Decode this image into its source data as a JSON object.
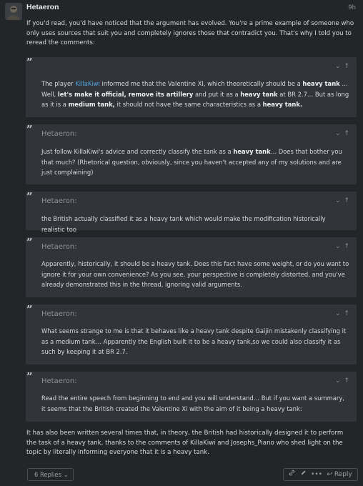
{
  "post": {
    "username": "Hetaeron",
    "time": "9h",
    "intro": "If you'd read, you'd have noticed that the argument has evolved. You're a prime example of someone who only uses sources that suit you and completely ignores those that contradict you. That's why I told you to reread the comments:",
    "closing": "It has also been written several times that, in theory, the British had historically designed it to perform the task of a heavy tank, thanks to the comments of KillaKiwi and Josephs_Piano who shed light on the topic by literally informing everyone that it is a heavy tank."
  },
  "quotes": [
    {
      "author": "Hetaeron:",
      "body_parts": {
        "a": "The player ",
        "link": "KillaKiwi",
        "b": " informed me that the Valentine XI, which theoretically should be a ",
        "c": "heavy tank",
        "d": " … Well, ",
        "e": "let's make it official, remove its artillery",
        "f": " and put it as a ",
        "g": "heavy tank",
        "h": " at BR 2.7… But as long as it is a ",
        "i": "medium tank,",
        "j": " it should not have the same characteristics as a ",
        "k": "heavy tank."
      }
    },
    {
      "author": "Hetaeron:",
      "body_parts": {
        "a": "Just follow KillaKiwi's advice and correctly classify the tank as a ",
        "b": "heavy tank",
        "c": "… Does that bother you that much? (Rhetorical question, obviously, since you haven't accepted any of my solutions and are just complaining)"
      }
    },
    {
      "author": "Hetaeron:",
      "body": "the British actually classified it as a heavy tank which would make the modification historically realistic too"
    },
    {
      "author": "Hetaeron:",
      "body": "Apparently, historically, it should be a heavy tank. Does this fact have some weight, or do you want to ignore it for your own convenience? As you see, your perspective is completely distorted, and you've already demonstrated this in the thread, ignoring valid arguments."
    },
    {
      "author": "Hetaeron:",
      "body": "What seems strange to me is that it behaves like a heavy tank despite Gaijin mistakenly classifying it as a medium tank… Apparently the English built it to be a heavy tank,so we could also classify it as such by keeping it at BR 2.7."
    },
    {
      "author": "Hetaeron:",
      "body": "Read the entire speech from beginning to end and you will understand… But if you want a summary, it seems that the British created the Valentine Xi with the aim of it being a heavy tank:"
    }
  ],
  "quote_controls": "⌄ ↑",
  "quote_mark": "”",
  "footer": {
    "replies_label": "6 Replies",
    "reply_label": "Reply"
  },
  "icons": {
    "quote": "quote-icon",
    "expand": "chevron-down-icon",
    "jump": "arrow-up-icon",
    "link": "link-icon",
    "edit": "pencil-icon",
    "more": "ellipsis-icon",
    "reply": "reply-icon"
  },
  "colors": {
    "background": "#232629",
    "quote_bg": "#313438",
    "text": "#d7d9dc",
    "muted": "#8f949a",
    "link": "#4fa6e2"
  }
}
